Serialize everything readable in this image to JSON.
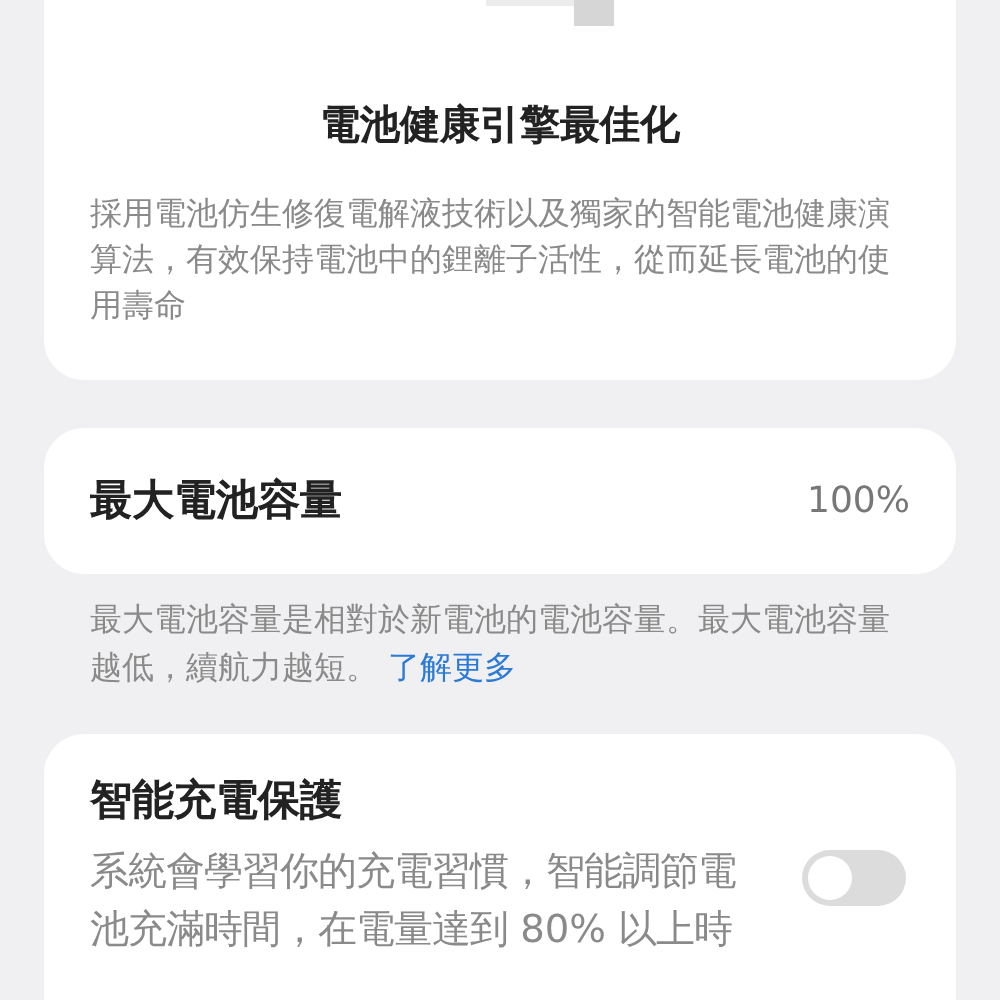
{
  "optimization_card": {
    "title": "電池健康引擎最佳化",
    "description": "採用電池仿生修復電解液技術以及獨家的智能電池健康演算法，有效保持電池中的鋰離子活性，從而延長電池的使用壽命"
  },
  "capacity_card": {
    "label": "最大電池容量",
    "value": "100%"
  },
  "capacity_note": {
    "text": "最大電池容量是相對於新電池的電池容量。最大電池容量越低，續航力越短。",
    "link": "了解更多"
  },
  "charging_card": {
    "title": "智能充電保護",
    "description": "系統會學習你的充電習慣，智能調節電池充滿時間，在電量達到 80% 以上時",
    "on": false
  }
}
